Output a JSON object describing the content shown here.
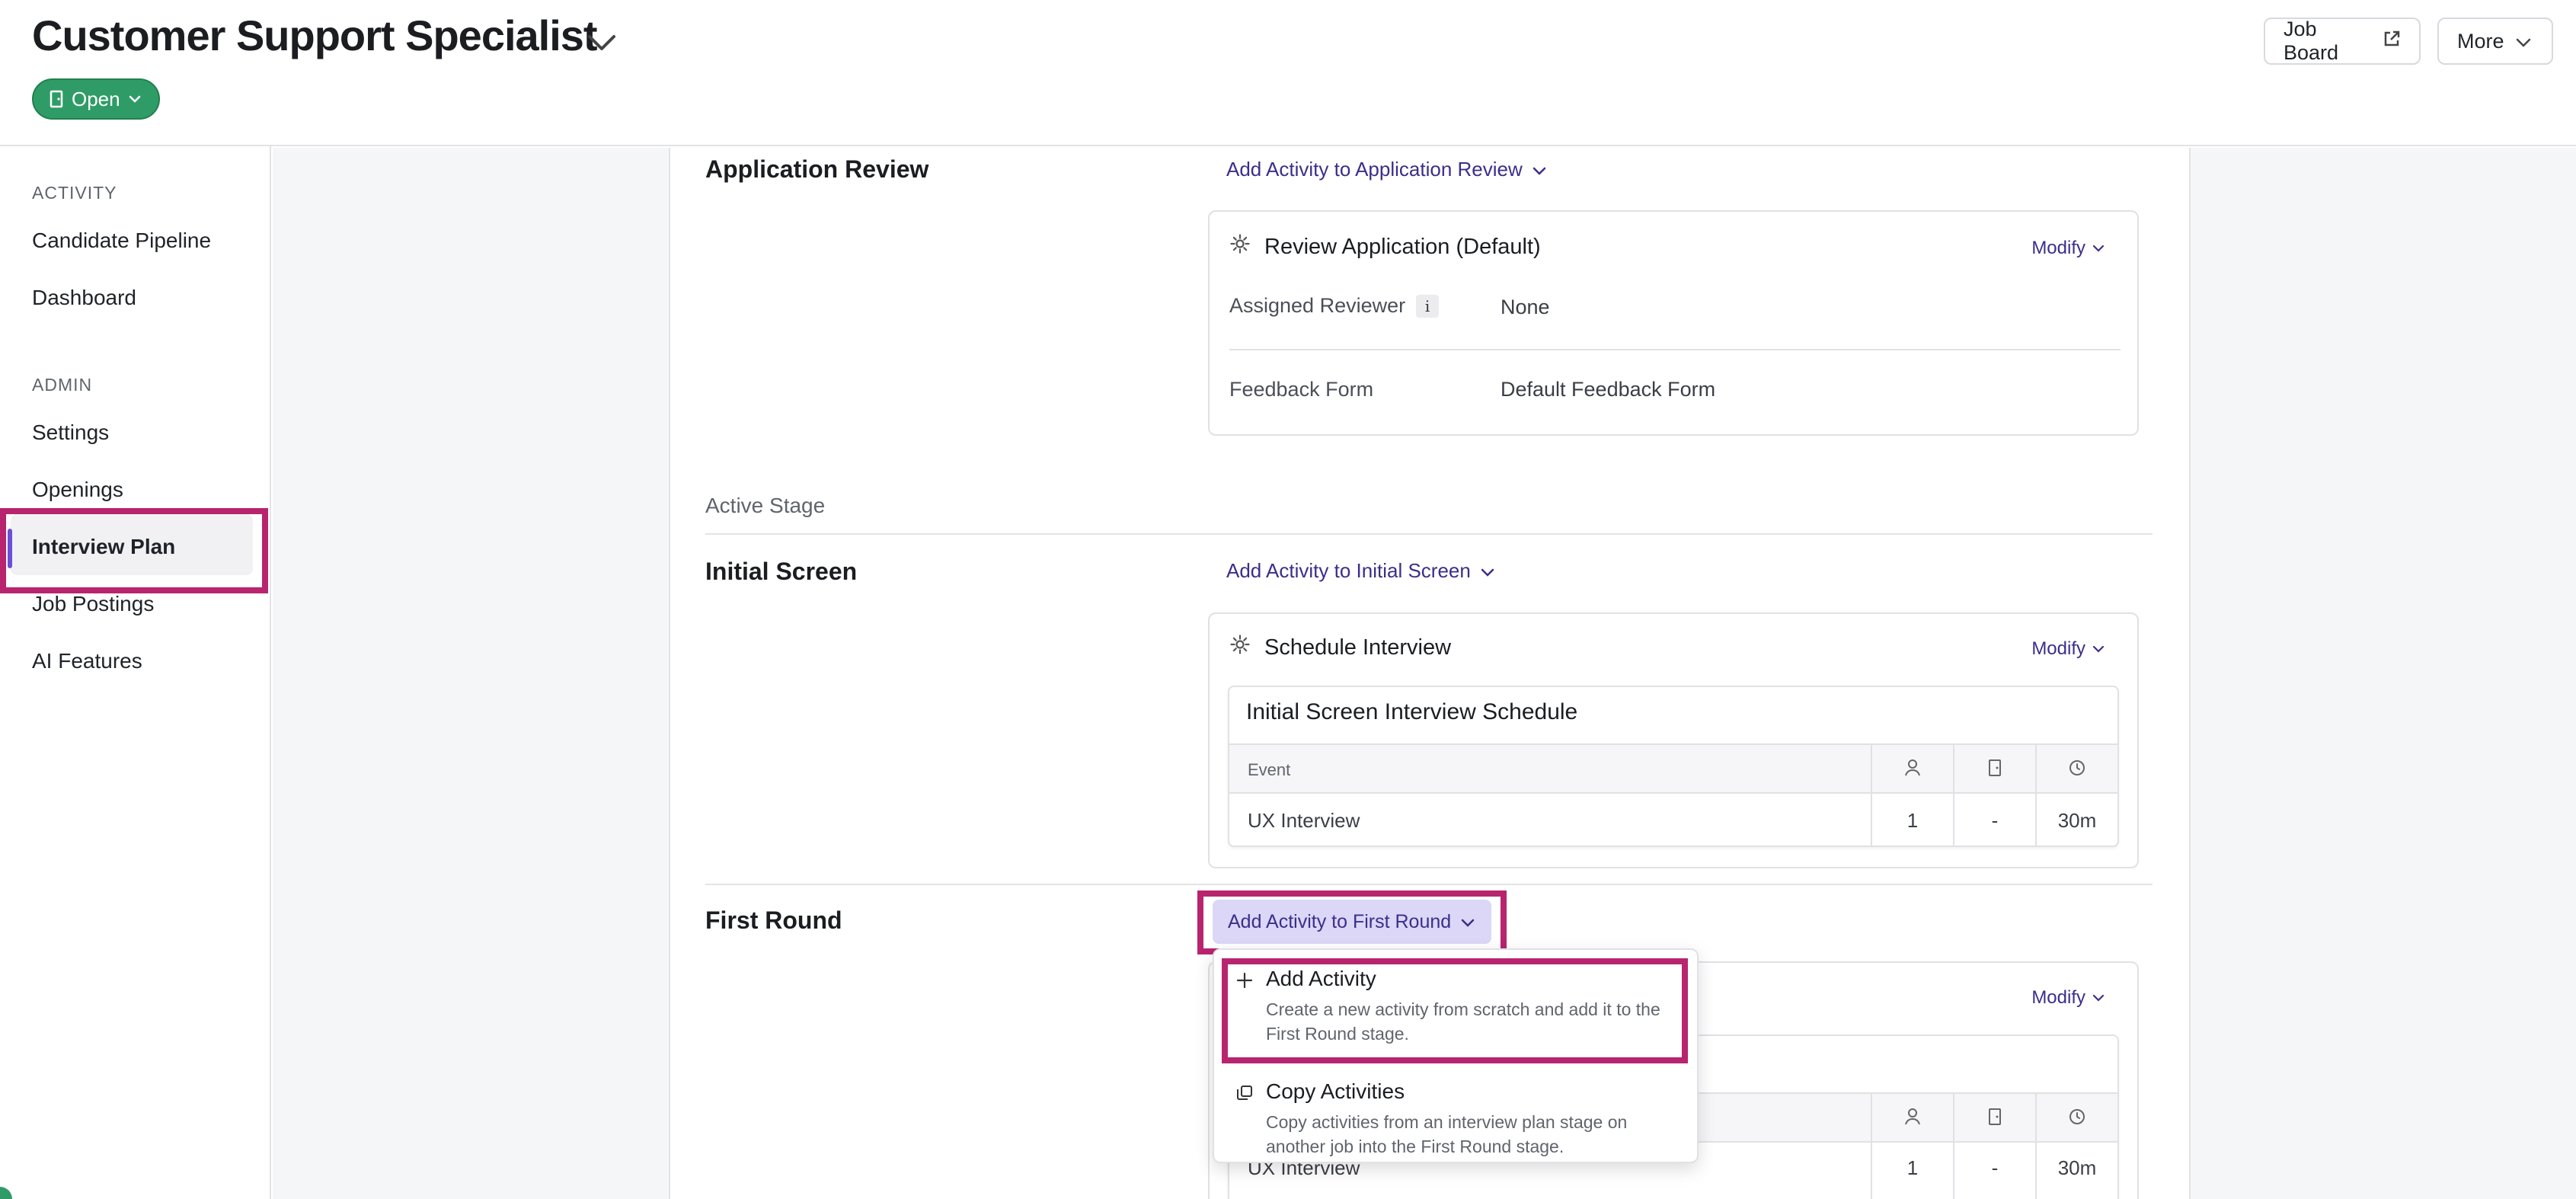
{
  "header": {
    "job_title": "Customer Support Specialist",
    "status": "Open",
    "job_board_label": "Job Board",
    "more_label": "More"
  },
  "sidebar": {
    "sections": [
      {
        "label": "ACTIVITY",
        "items": [
          "Candidate Pipeline",
          "Dashboard"
        ]
      },
      {
        "label": "ADMIN",
        "items": [
          "Settings",
          "Openings",
          "Interview Plan",
          "Job Postings",
          "AI Features"
        ]
      }
    ],
    "active_item": "Interview Plan"
  },
  "stages": {
    "application_review": {
      "title": "Application Review",
      "add_label": "Add Activity to Application Review",
      "activity": {
        "name": "Review Application (Default)",
        "modify_label": "Modify",
        "assigned_reviewer_label": "Assigned Reviewer",
        "info_glyph": "i",
        "assigned_reviewer_value": "None",
        "feedback_form_label": "Feedback Form",
        "feedback_form_value": "Default Feedback Form"
      }
    },
    "active_stage_label": "Active Stage",
    "initial_screen": {
      "title": "Initial Screen",
      "add_label": "Add Activity to Initial Screen",
      "activity": {
        "name": "Schedule Interview",
        "modify_label": "Modify",
        "schedule_title": "Initial Screen Interview Schedule",
        "columns": {
          "event": "Event"
        },
        "rows": [
          {
            "event": "UX Interview",
            "interviewers": "1",
            "room": "-",
            "duration": "30m"
          }
        ]
      }
    },
    "first_round": {
      "title": "First Round",
      "add_label": "Add Activity to First Round",
      "activity": {
        "modify_label": "Modify",
        "rows": [
          {
            "event": "UX Interview",
            "interviewers": "1",
            "room": "-",
            "duration": "30m"
          }
        ]
      }
    }
  },
  "dropdown": {
    "items": [
      {
        "icon": "plus-icon",
        "title": "Add Activity",
        "description": "Create a new activity from scratch and add it to the First Round stage."
      },
      {
        "icon": "copy-icon",
        "title": "Copy Activities",
        "description": "Copy activities from an interview plan stage on another job into the First Round stage."
      }
    ]
  },
  "colors": {
    "accent": "#3a2f8a",
    "status_green": "#2f9c67",
    "highlight": "#b8246e",
    "sidebar_active_bar": "#6b4fd8"
  }
}
